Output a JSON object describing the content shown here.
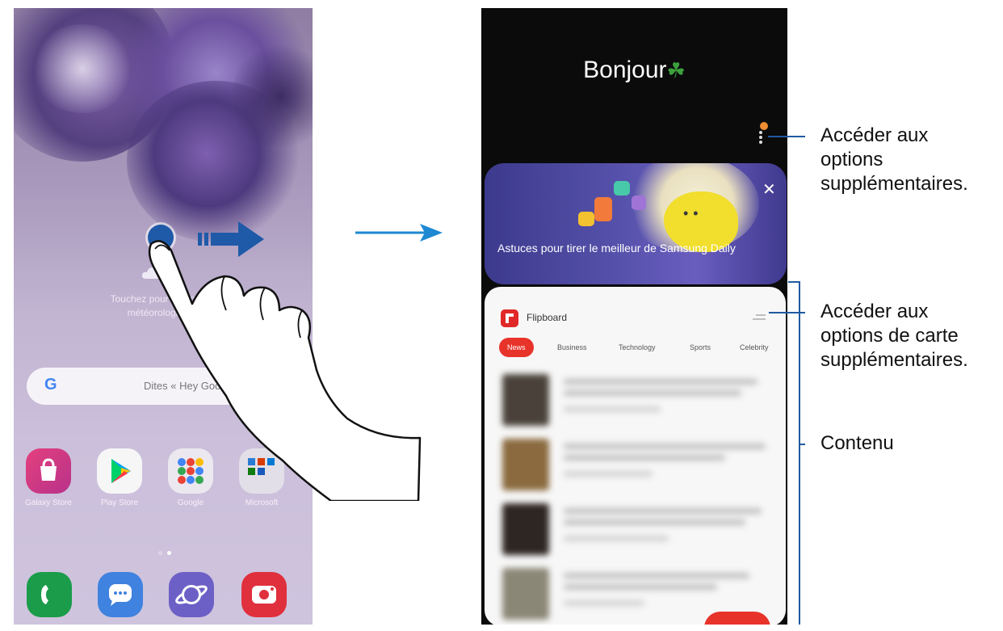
{
  "home_screen": {
    "weather_hint_line1": "Touchez pour obtenir les",
    "weather_hint_line2": "météorologiques",
    "search_placeholder": "Dites « Hey Goo",
    "apps": [
      {
        "label": "Galaxy Store",
        "icon": "galaxy-store-icon"
      },
      {
        "label": "Play Store",
        "icon": "play-store-icon"
      },
      {
        "label": "Google",
        "icon": "google-folder-icon"
      },
      {
        "label": "Microsoft",
        "icon": "microsoft-folder-icon"
      }
    ],
    "dock": [
      "phone-icon",
      "messages-icon",
      "internet-icon",
      "camera-icon"
    ]
  },
  "samsung_daily": {
    "greeting": "Bonjour",
    "banner_text": "Astuces pour tirer le meilleur de Samsung Daily",
    "card": {
      "source": "Flipboard",
      "tabs": [
        "News",
        "Business",
        "Technology",
        "Sports",
        "Celebrity"
      ],
      "active_tab": "News"
    }
  },
  "callouts": {
    "more_options_l1": "Accéder aux",
    "more_options_l2": "options",
    "more_options_l3": "supplémentaires.",
    "card_options_l1": "Accéder aux",
    "card_options_l2": "options de carte",
    "card_options_l3": "supplémentaires.",
    "content": "Contenu"
  },
  "colors": {
    "accent_blue": "#1f5aa0",
    "flipboard_red": "#e8332a"
  }
}
